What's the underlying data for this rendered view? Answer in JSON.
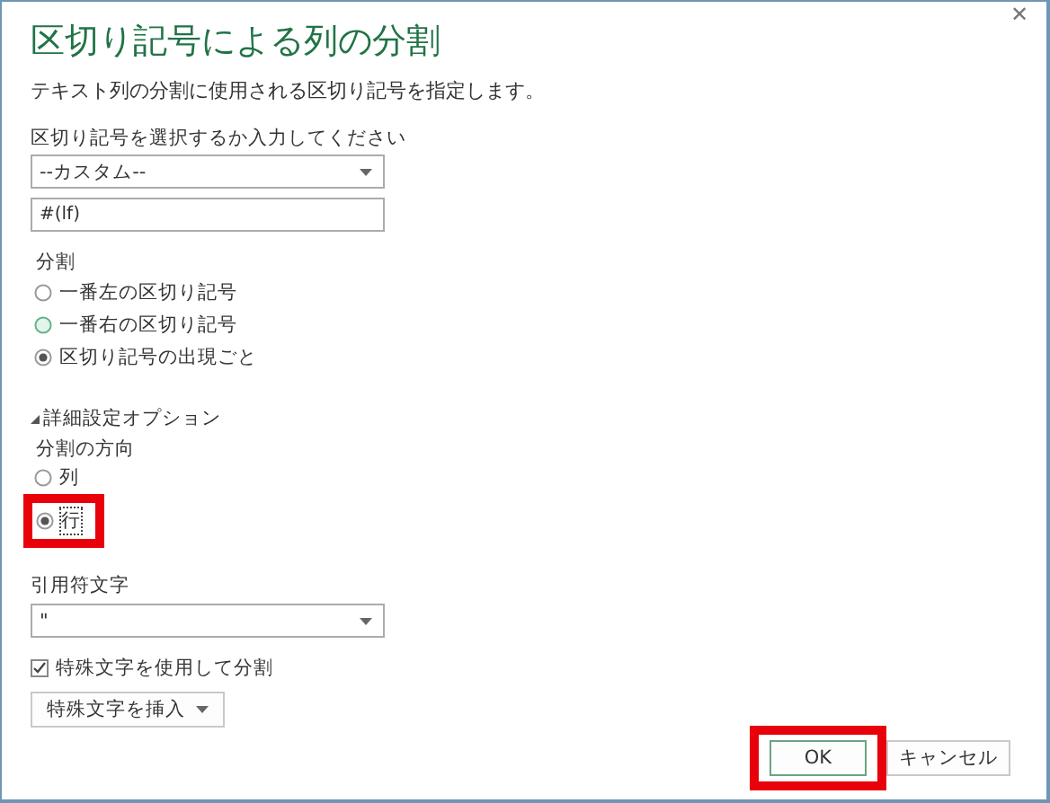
{
  "window": {
    "title": "区切り記号による列の分割",
    "close": "✕"
  },
  "description": "テキスト列の分割に使用される区切り記号を指定します。",
  "delimiter": {
    "label": "区切り記号を選択するか入力してください",
    "value": "--カスタム--",
    "custom_value": "#(lf)"
  },
  "split_at": {
    "label": "分割",
    "options": [
      {
        "label": "一番左の区切り記号",
        "selected": false,
        "hovered": false
      },
      {
        "label": "一番右の区切り記号",
        "selected": false,
        "hovered": true
      },
      {
        "label": "区切り記号の出現ごと",
        "selected": true,
        "hovered": false
      }
    ]
  },
  "advanced": {
    "label": "詳細設定オプション",
    "expanded": true,
    "direction": {
      "label": "分割の方向",
      "options": [
        {
          "label": "列",
          "selected": false,
          "focused": false,
          "highlighted": false
        },
        {
          "label": "行",
          "selected": true,
          "focused": true,
          "highlighted": true
        }
      ]
    },
    "quote": {
      "label": "引用符文字",
      "value": "\""
    },
    "special": {
      "label": "特殊文字を使用して分割",
      "checked": true
    },
    "insert_button": "特殊文字を挿入"
  },
  "buttons": [
    {
      "label": "OK",
      "kind": "primary",
      "highlighted": true
    },
    {
      "label": "キャンセル",
      "kind": "secondary",
      "highlighted": false
    }
  ]
}
